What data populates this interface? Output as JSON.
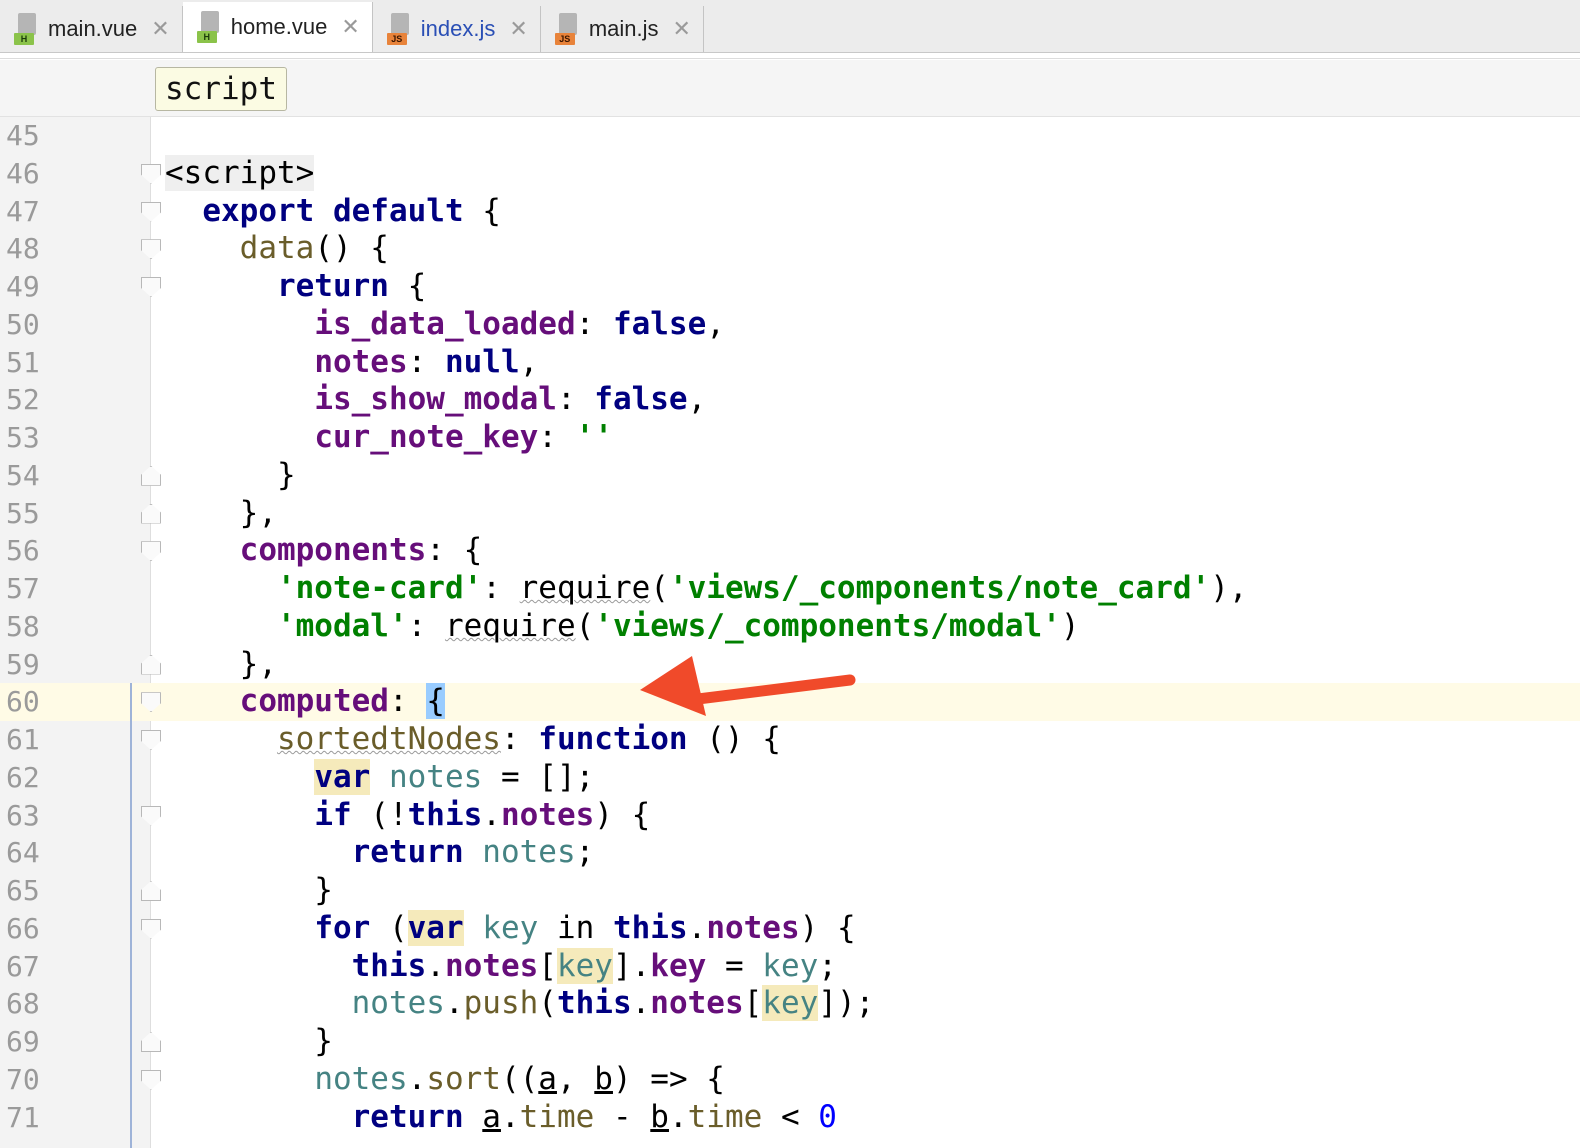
{
  "tabs": [
    {
      "label": "main.vue",
      "badge": "H",
      "type": "vue",
      "active": false
    },
    {
      "label": "home.vue",
      "badge": "H",
      "type": "vue",
      "active": true
    },
    {
      "label": "index.js",
      "badge": "JS",
      "type": "js",
      "active": false
    },
    {
      "label": "main.js",
      "badge": "JS",
      "type": "js",
      "active": false
    }
  ],
  "breadcrumb": {
    "label": "script"
  },
  "current_line": "60",
  "line_numbers": [
    "45",
    "46",
    "47",
    "48",
    "49",
    "50",
    "51",
    "52",
    "53",
    "54",
    "55",
    "56",
    "57",
    "58",
    "59",
    "60",
    "61",
    "62",
    "63",
    "64",
    "65",
    "66",
    "67",
    "68",
    "69",
    "70",
    "71"
  ],
  "code": {
    "script_tag": "<script>",
    "export_kw": "export",
    "default_kw": "default",
    "data_fn": "data",
    "return_kw": "return",
    "is_data_loaded": "is_data_loaded",
    "false_kw": "false",
    "notes_prop": "notes",
    "null_kw": "null",
    "is_show_modal": "is_show_modal",
    "cur_note_key": "cur_note_key",
    "empty_str": "''",
    "components_prop": "components",
    "note_card_key": "'note-card'",
    "require_fn": "require",
    "note_card_path": "'views/_components/note_card'",
    "modal_key": "'modal'",
    "modal_path": "'views/_components/modal'",
    "computed_prop": "computed",
    "sorted_nodes": "sortedtNodes",
    "function_kw": "function",
    "var_kw": "var",
    "notes_var": "notes",
    "if_kw": "if",
    "this_kw": "this",
    "for_kw": "for",
    "key_var": "key",
    "in_kw": "in",
    "key_prop": "key",
    "push_fn": "push",
    "sort_fn": "sort",
    "a_param": "a",
    "b_param": "b",
    "time_prop": "time",
    "zero": "0"
  },
  "colors": {
    "keyword": "#000080",
    "property": "#660e7a",
    "string": "#008000",
    "variable": "#458383",
    "annotation_arrow": "#f04a2a"
  }
}
